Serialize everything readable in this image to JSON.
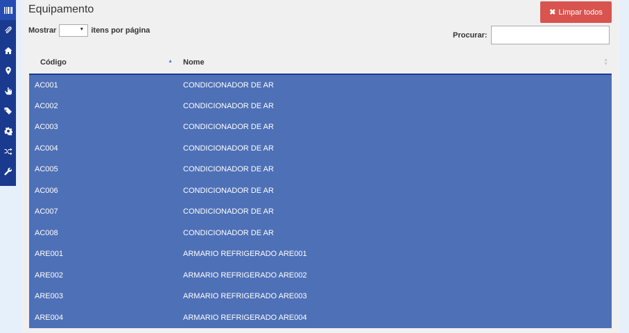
{
  "sidebar": {
    "items": [
      {
        "icon": "barcode-icon"
      },
      {
        "icon": "paperclip-icon"
      },
      {
        "icon": "home-icon"
      },
      {
        "icon": "map-marker-icon"
      },
      {
        "icon": "hand-icon"
      },
      {
        "icon": "tags-icon"
      },
      {
        "icon": "gear-icon"
      },
      {
        "icon": "random-icon"
      },
      {
        "icon": "wrench-icon"
      }
    ]
  },
  "header": {
    "title": "Equipamento",
    "clear_button_label": "Limpar todos"
  },
  "table_controls": {
    "show_label": "Mostrar",
    "per_page_value": "",
    "per_page_suffix": "itens por página",
    "search_label": "Procurar:",
    "search_value": ""
  },
  "table": {
    "columns": [
      "Código",
      "Nome"
    ],
    "rows": [
      [
        "AC001",
        "CONDICIONADOR DE AR"
      ],
      [
        "AC002",
        "CONDICIONADOR DE AR"
      ],
      [
        "AC003",
        "CONDICIONADOR DE AR"
      ],
      [
        "AC004",
        "CONDICIONADOR DE AR"
      ],
      [
        "AC005",
        "CONDICIONADOR DE AR"
      ],
      [
        "AC006",
        "CONDICIONADOR DE AR"
      ],
      [
        "AC007",
        "CONDICIONADOR DE AR"
      ],
      [
        "AC008",
        "CONDICIONADOR DE AR"
      ],
      [
        "ARE001",
        "ARMARIO REFRIGERADO ARE001"
      ],
      [
        "ARE002",
        "ARMARIO REFRIGERADO ARE002"
      ],
      [
        "ARE003",
        "ARMARIO REFRIGERADO ARE003"
      ],
      [
        "ARE004",
        "ARMARIO REFRIGERADO ARE004"
      ]
    ]
  },
  "colors": {
    "sidebar": "#1a3a8f",
    "row_selected": "#4e70b6",
    "danger": "#d9534f"
  }
}
